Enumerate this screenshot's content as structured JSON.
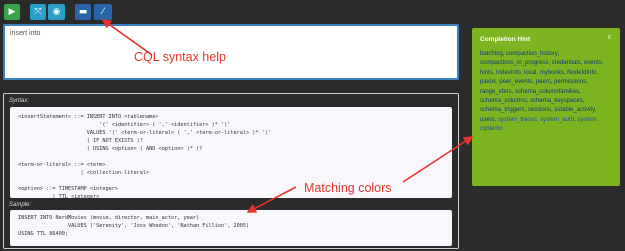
{
  "toolbar": {
    "run_icon": "play-icon",
    "expand_icon": "expand-icon",
    "view_icon": "eye-icon",
    "comment_icon": "comment-icon",
    "edit_icon": "pencil-icon",
    "glyphs": [
      "▶",
      "⤧",
      "◉",
      "▬",
      "⁄"
    ]
  },
  "query": {
    "value": "insert into"
  },
  "annotations": {
    "cql_help": "CQL syntax help",
    "matching_colors": "Matching colors",
    "color": "#e8352a"
  },
  "syntax": {
    "label": "Syntax:",
    "lines": [
      "<insertStatement> ::= INSERT INTO <tablename>",
      "                          '(' <identifier> ( ',' <identifier> )* ')'",
      "                      VALUES '(' <term-or-literal> ( ',' <term-or-literal> )* ')'",
      "                      ( IF NOT EXISTS )?",
      "                      ( USING <option> ( AND <option> )* )?",
      "",
      "<term-or-literal> ::= <term>",
      "                    | <collection-literal>",
      "",
      "<option> ::= TIMESTAMP <integer>",
      "           | TTL <integer>"
    ]
  },
  "sample": {
    "label": "Sample:",
    "lines": [
      "INSERT INTO NerdMovies (movie, director, main_actor, year)",
      "                VALUES ('Serenity', 'Joss Whedon', 'Nathan Fillion', 2005)",
      "USING TTL 86400;"
    ]
  },
  "hint": {
    "title": "Completion Hint",
    "close": "x",
    "items": [
      "batchlog,",
      "compaction_history,",
      "compactions_in_progress,",
      "credentials,",
      "events,",
      "hints,",
      "IndexInfo,",
      "local,",
      "mybooks,",
      "NodeIdInfo,",
      "paxos,",
      "peer_events,",
      "peers,",
      "permissions,",
      "range_xfers,",
      "schema_columnfamilies,",
      "schema_columns,",
      "schema_keyspaces,",
      "schema_triggers,",
      "sessions,",
      "sstable_activity,",
      "users,",
      "system_traces,",
      "system_auth,",
      "system,",
      "cqldemo"
    ],
    "bg": "#7db521"
  }
}
